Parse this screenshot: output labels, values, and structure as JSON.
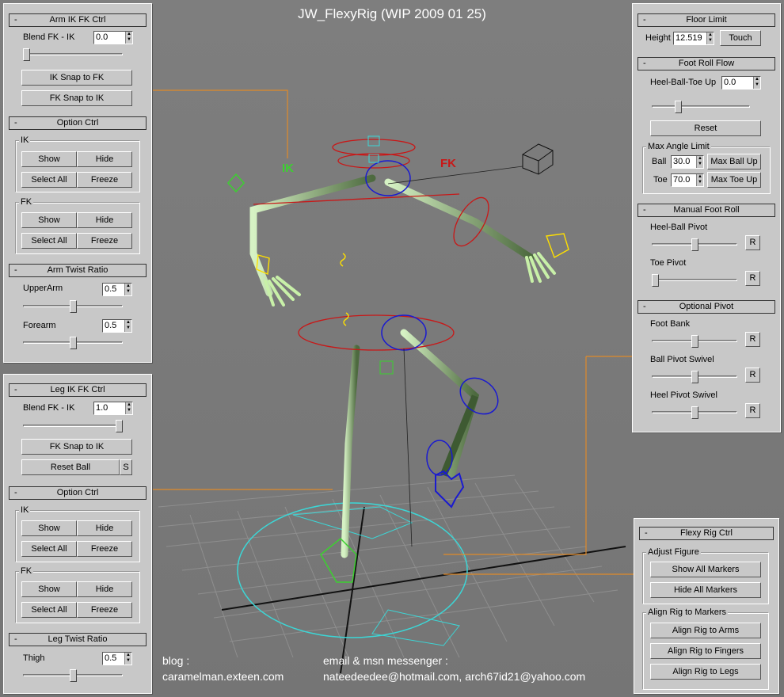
{
  "title": "JW_FlexyRig (WIP 2009 01 25)",
  "footer": {
    "blog_label": "blog :",
    "blog_url": "caramelman.exteen.com",
    "email_label": "email & msn messenger :",
    "emails": "nateedeedee@hotmail.com, arch67id21@yahoo.com"
  },
  "viewport_markers": {
    "ik": "IK",
    "fk": "FK"
  },
  "arm_ik_fk": {
    "title": "Arm IK FK Ctrl",
    "minus": "-",
    "blend_label": "Blend FK - IK",
    "blend_value": "0.0",
    "blend_level": 0.0,
    "ik_snap": "IK Snap to FK",
    "fk_snap": "FK Snap to IK"
  },
  "arm_option": {
    "title": "Option Ctrl",
    "minus": "-",
    "ik_group": "IK",
    "fk_group": "FK",
    "show": "Show",
    "hide": "Hide",
    "select_all": "Select All",
    "freeze": "Freeze"
  },
  "arm_twist": {
    "title": "Arm Twist Ratio",
    "minus": "-",
    "upper_label": "UpperArm",
    "upper_value": "0.5",
    "upper_level": 0.5,
    "fore_label": "Forearm",
    "fore_value": "0.5",
    "fore_level": 0.5
  },
  "leg_ik_fk": {
    "title": "Leg IK FK Ctrl",
    "minus": "-",
    "blend_label": "Blend FK - IK",
    "blend_value": "1.0",
    "blend_level": 1.0,
    "fk_snap": "FK Snap to IK",
    "reset_ball": "Reset Ball",
    "s": "S"
  },
  "leg_option": {
    "title": "Option Ctrl",
    "minus": "-",
    "ik_group": "IK",
    "fk_group": "FK",
    "show": "Show",
    "hide": "Hide",
    "select_all": "Select All",
    "freeze": "Freeze"
  },
  "leg_twist": {
    "title": "Leg Twist Ratio",
    "minus": "-",
    "thigh_label": "Thigh",
    "thigh_value": "0.5",
    "thigh_level": 0.5
  },
  "floor_limit": {
    "title": "Floor Limit",
    "minus": "-",
    "height_label": "Height",
    "height_value": "12.519",
    "touch": "Touch"
  },
  "foot_roll_flow": {
    "title": "Foot Roll Flow",
    "minus": "-",
    "htb_label": "Heel-Ball-Toe Up",
    "htb_value": "0.0",
    "htb_level": 0.25,
    "reset": "Reset",
    "max_angle_group": "Max Angle Limit",
    "ball_label": "Ball",
    "ball_value": "30.0",
    "max_ball_up": "Max Ball Up",
    "toe_label": "Toe",
    "toe_value": "70.0",
    "max_toe_up": "Max Toe Up"
  },
  "manual_foot_roll": {
    "title": "Manual Foot Roll",
    "minus": "-",
    "heel_ball_label": "Heel-Ball Pivot",
    "heel_ball_level": 0.5,
    "toe_label": "Toe Pivot",
    "toe_level": 0.0,
    "r": "R"
  },
  "optional_pivot": {
    "title": "Optional Pivot",
    "minus": "-",
    "foot_bank_label": "Foot Bank",
    "foot_bank_level": 0.5,
    "ball_swivel_label": "Ball Pivot Swivel",
    "ball_swivel_level": 0.5,
    "heel_swivel_label": "Heel Pivot Swivel",
    "heel_swivel_level": 0.5,
    "r": "R"
  },
  "flexy_rig": {
    "title": "Flexy Rig Ctrl",
    "minus": "-",
    "adjust_group": "Adjust Figure",
    "show_markers": "Show All Markers",
    "hide_markers": "Hide All Markers",
    "align_group": "Align Rig to Markers",
    "align_arms": "Align Rig to Arms",
    "align_fingers": "Align Rig to Fingers",
    "align_legs": "Align Rig to Legs"
  }
}
